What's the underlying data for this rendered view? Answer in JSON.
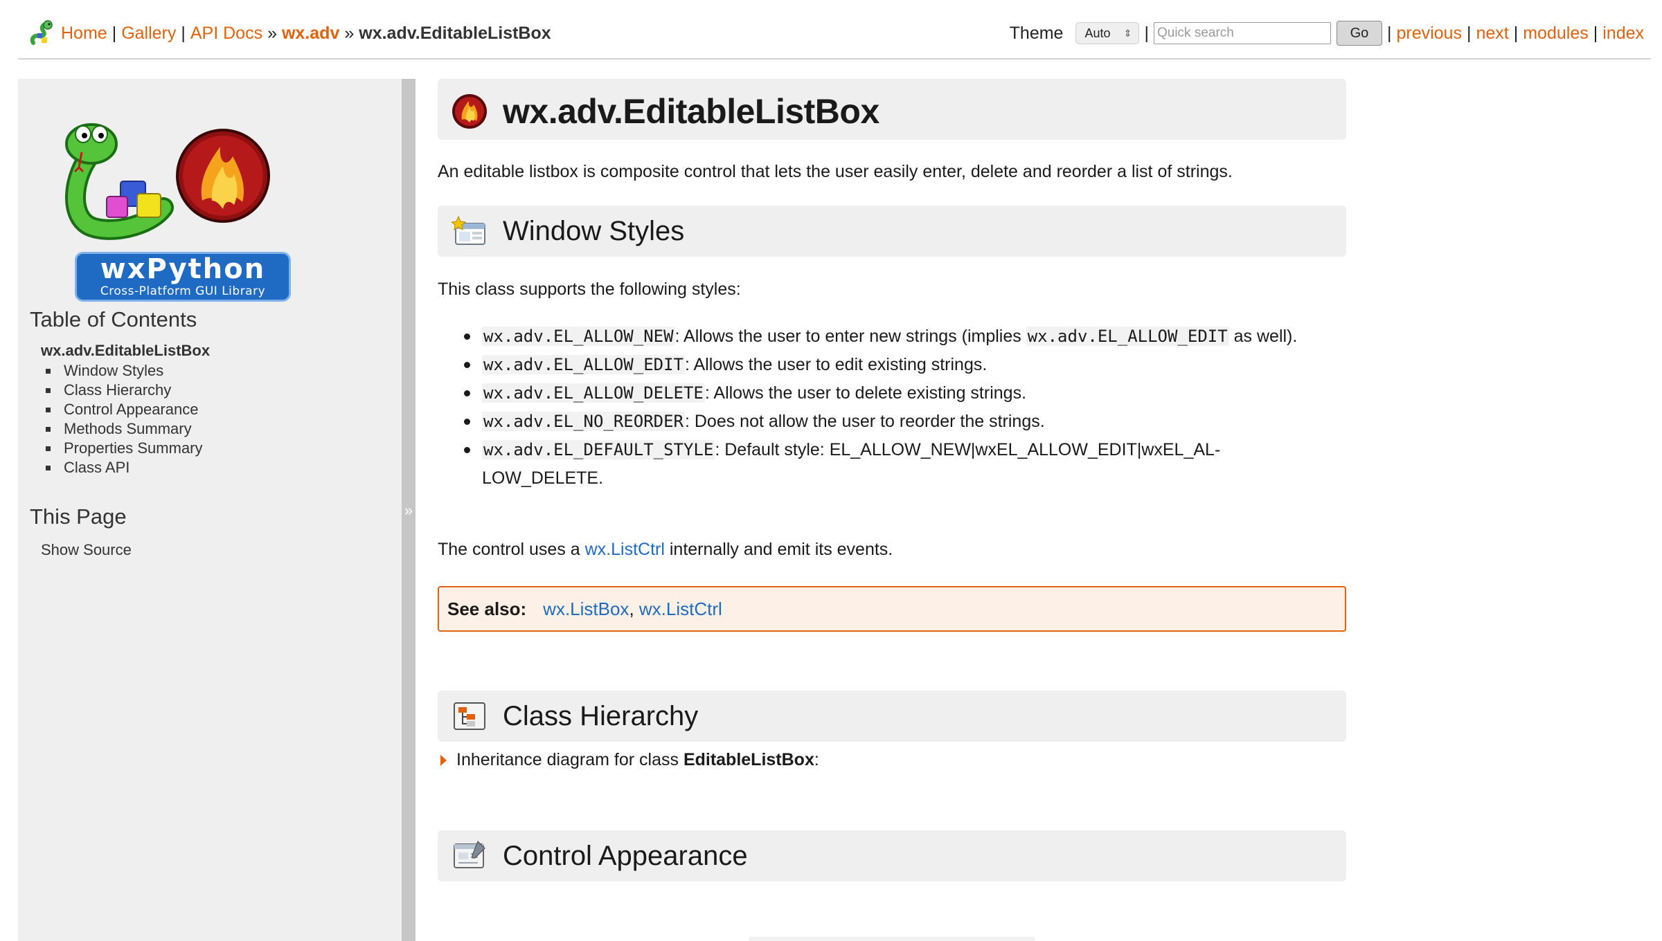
{
  "breadcrumb": {
    "home": "Home",
    "gallery": "Gallery",
    "api_docs": "API Docs",
    "module": "wx.adv",
    "current": "wx.adv.EditableListBox",
    "sep_pipe": "|",
    "sep_arrow": "»"
  },
  "topnav": {
    "theme_label": "Theme",
    "theme_value": "Auto",
    "search_placeholder": "Quick search",
    "go_label": "Go",
    "pipe": "|",
    "previous": "previous",
    "next": "next",
    "modules": "modules",
    "index": "index"
  },
  "logo": {
    "name": "wxPython",
    "tagline": "Cross-Platform GUI Library"
  },
  "sidebar": {
    "toc_title": "Table of Contents",
    "toc_root": "wx.adv.EditableListBox",
    "toc_items": [
      "Window Styles",
      "Class Hierarchy",
      "Control Appearance",
      "Methods Summary",
      "Properties Summary",
      "Class API"
    ],
    "this_page_title": "This Page",
    "show_source": "Show Source",
    "collapse_glyph": "»"
  },
  "main": {
    "title": "wx.adv.EditableListBox",
    "description": "An editable listbox is composite control that lets the user easily enter, delete and reorder a list of strings.",
    "window_styles": {
      "heading": "Window Styles",
      "intro": "This class supports the following styles:",
      "items": [
        {
          "code": "wx.adv.EL_ALLOW_NEW",
          "text_before": ": Allows the user to enter new strings (implies ",
          "code2": "wx.adv.EL_ALLOW_EDIT",
          "text_after": " as well)."
        },
        {
          "code": "wx.adv.EL_ALLOW_EDIT",
          "text": ": Allows the user to edit existing strings."
        },
        {
          "code": "wx.adv.EL_ALLOW_DELETE",
          "text": ": Allows the user to delete existing strings."
        },
        {
          "code": "wx.adv.EL_NO_REORDER",
          "text": ": Does not allow the user to reorder the strings."
        },
        {
          "code": "wx.adv.EL_DEFAULT_STYLE",
          "text": ": Default style: EL_ALLOW_NEW|wxEL_ALLOW_EDIT|wxEL_AL-LOW_DELETE."
        }
      ],
      "control_uses_before": "The control uses a ",
      "control_uses_link": "wx.ListCtrl",
      "control_uses_after": " internally and emit its events."
    },
    "see_also": {
      "label": "See also:",
      "link1": "wx.ListBox",
      "comma": ",",
      "link2": "wx.ListCtrl"
    },
    "class_hierarchy": {
      "heading": "Class Hierarchy",
      "inherit_before": "Inheritance diagram for class ",
      "inherit_class": "EditableListBox",
      "inherit_after": ":"
    },
    "control_appearance": {
      "heading": "Control Appearance"
    }
  },
  "colors": {
    "link_orange": "#e0620d",
    "link_blue": "#1f6bc4",
    "section_bg": "#efefef",
    "see_also_bg": "#fdf0e6"
  }
}
